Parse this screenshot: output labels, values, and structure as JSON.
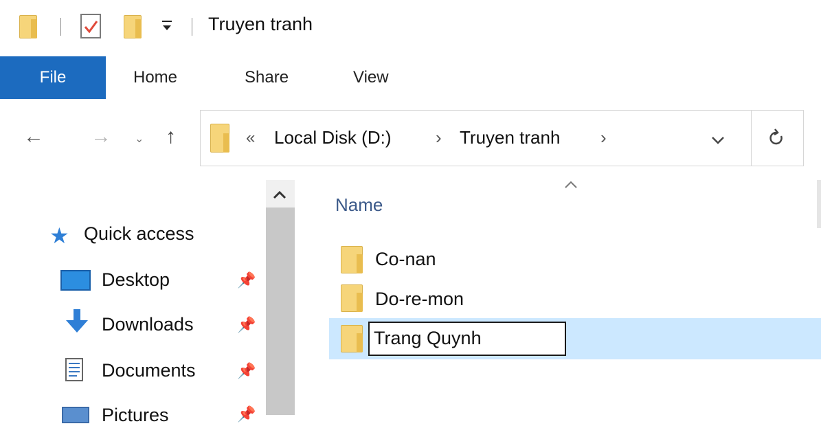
{
  "window": {
    "title": "Truyen tranh"
  },
  "ribbon": {
    "tabs": [
      "File",
      "Home",
      "Share",
      "View"
    ]
  },
  "address": {
    "overflow": "«",
    "crumbs": [
      "Local Disk (D:)",
      "Truyen tranh"
    ],
    "separator": "›"
  },
  "nav": {
    "items": [
      {
        "label": "Quick access",
        "icon": "star-icon"
      },
      {
        "label": "Desktop",
        "icon": "desktop-icon",
        "pinned": true
      },
      {
        "label": "Downloads",
        "icon": "download-arrow-icon",
        "pinned": true
      },
      {
        "label": "Documents",
        "icon": "document-icon",
        "pinned": true
      },
      {
        "label": "Pictures",
        "icon": "picture-icon",
        "pinned": true
      }
    ]
  },
  "content": {
    "column_header": "Name",
    "items": [
      {
        "name": "Co-nan"
      },
      {
        "name": "Do-re-mon"
      },
      {
        "name": "Trang Quynh",
        "selected": true,
        "renaming": true
      }
    ]
  },
  "colors": {
    "file_tab": "#1c6bbf",
    "selection": "#cce8ff",
    "folder": "#f6d57a"
  }
}
